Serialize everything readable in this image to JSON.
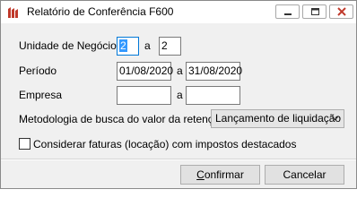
{
  "window": {
    "title": "Relatório de Conferência F600",
    "icons": {
      "app": "app-logo-icon",
      "minimize": "minimize-icon",
      "maximize": "maximize-icon",
      "close": "close-icon"
    }
  },
  "form": {
    "unidade_label": "Unidade de Negócio",
    "unidade_from": "2",
    "unidade_sep": "a",
    "unidade_to": "2",
    "periodo_label": "Período",
    "periodo_from": "01/08/2020",
    "periodo_sep": "a",
    "periodo_to": "31/08/2020",
    "empresa_label": "Empresa",
    "empresa_from": "",
    "empresa_sep": "a",
    "empresa_to": "",
    "metodologia_label": "Metodologia de busca do valor da retenção",
    "metodologia_value": "Lançamento de liquidação",
    "considerar_label": "Considerar faturas (locação) com impostos destacados",
    "considerar_checked": false
  },
  "buttons": {
    "confirm_first": "C",
    "confirm_rest": "onfirmar",
    "cancel_label": "Cancelar"
  },
  "colors": {
    "focus": "#0078d7",
    "selection": "#3399ff",
    "logo": "#c0392b"
  }
}
